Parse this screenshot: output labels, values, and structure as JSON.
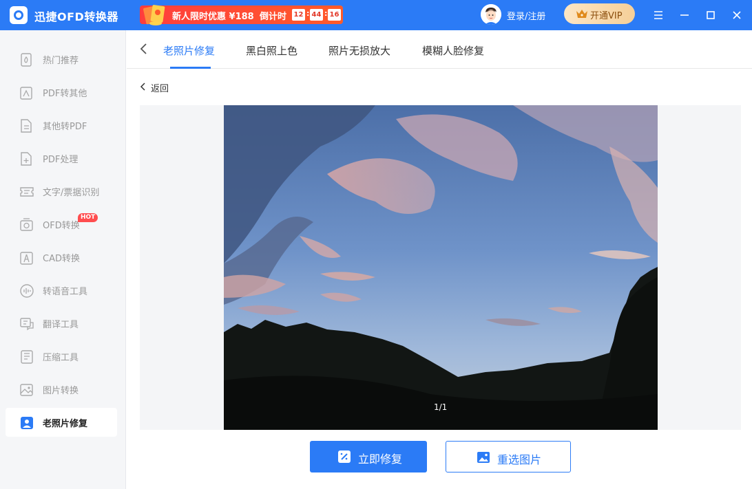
{
  "app": {
    "title": "迅捷OFD转换器"
  },
  "promo": {
    "text": "新人限时优惠 ¥188",
    "countdown_label": "倒计时",
    "hours": "12",
    "minutes": "44",
    "seconds": "16",
    "separator": ":"
  },
  "header": {
    "login_label": "登录/注册",
    "vip_label": "开通VIP"
  },
  "sidebar": {
    "items": [
      {
        "label": "热门推荐",
        "icon": "hot-recommend-icon"
      },
      {
        "label": "PDF转其他",
        "icon": "pdf-convert-icon"
      },
      {
        "label": "其他转PDF",
        "icon": "to-pdf-icon"
      },
      {
        "label": "PDF处理",
        "icon": "pdf-process-icon"
      },
      {
        "label": "文字/票据识别",
        "icon": "ocr-icon"
      },
      {
        "label": "OFD转换",
        "icon": "ofd-icon",
        "badge": "HOT"
      },
      {
        "label": "CAD转换",
        "icon": "cad-icon"
      },
      {
        "label": "转语音工具",
        "icon": "voice-icon"
      },
      {
        "label": "翻译工具",
        "icon": "translate-icon"
      },
      {
        "label": "压缩工具",
        "icon": "compress-icon"
      },
      {
        "label": "图片转换",
        "icon": "image-convert-icon"
      },
      {
        "label": "老照片修复",
        "icon": "photo-repair-icon",
        "active": true
      }
    ]
  },
  "tabs": [
    {
      "label": "老照片修复",
      "active": true
    },
    {
      "label": "黑白照上色"
    },
    {
      "label": "照片无损放大"
    },
    {
      "label": "模糊人脸修复"
    }
  ],
  "back_label": "返回",
  "preview": {
    "page_indicator": "1/1"
  },
  "actions": {
    "repair_label": "立即修复",
    "reselect_label": "重选图片"
  },
  "colors": {
    "accent": "#2b7bf6",
    "promo": "#ff3d3d",
    "vip_gold": "#f5cf98"
  }
}
